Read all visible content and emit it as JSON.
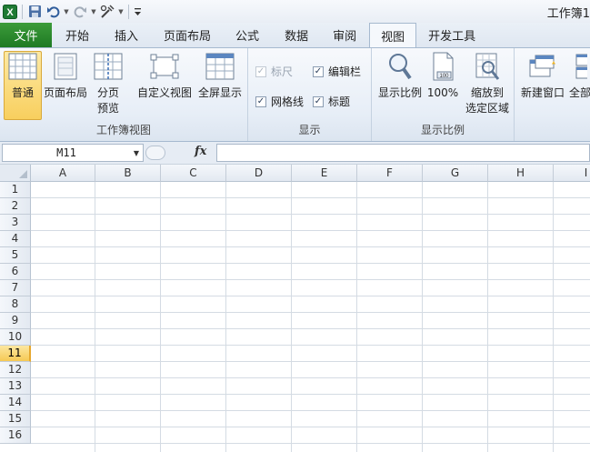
{
  "window": {
    "title": "工作簿1"
  },
  "tabs": [
    "文件",
    "开始",
    "插入",
    "页面布局",
    "公式",
    "数据",
    "审阅",
    "视图",
    "开发工具"
  ],
  "active_tab": "视图",
  "ribbon": {
    "workbook_views": {
      "label": "工作簿视图",
      "normal": "普通",
      "page_layout": "页面布局",
      "page_break_line1": "分页",
      "page_break_line2": "预览",
      "custom_views": "自定义视图",
      "full_screen": "全屏显示"
    },
    "show": {
      "label": "显示",
      "ruler": "标尺",
      "formula_bar": "编辑栏",
      "gridlines": "网格线",
      "headings": "标题"
    },
    "zoom": {
      "label": "显示比例",
      "zoom": "显示比例",
      "hundred": "100%",
      "zoom_selection_line1": "缩放到",
      "zoom_selection_line2": "选定区域"
    },
    "window": {
      "new_window": "新建窗口",
      "arrange_all_partial": "全部"
    }
  },
  "formula_bar": {
    "name_box": "M11",
    "fx": "fx",
    "value": ""
  },
  "sheet": {
    "columns": [
      "A",
      "B",
      "C",
      "D",
      "E",
      "F",
      "G",
      "H",
      "I"
    ],
    "rows": [
      "1",
      "2",
      "3",
      "4",
      "5",
      "6",
      "7",
      "8",
      "9",
      "10",
      "11",
      "12",
      "13",
      "14",
      "15",
      "16"
    ],
    "selected_row": "11"
  },
  "colors": {
    "file_tab": "#2a8a2e",
    "selected_highlight": "#f8cf5e",
    "gridline": "#d4dbe3"
  }
}
